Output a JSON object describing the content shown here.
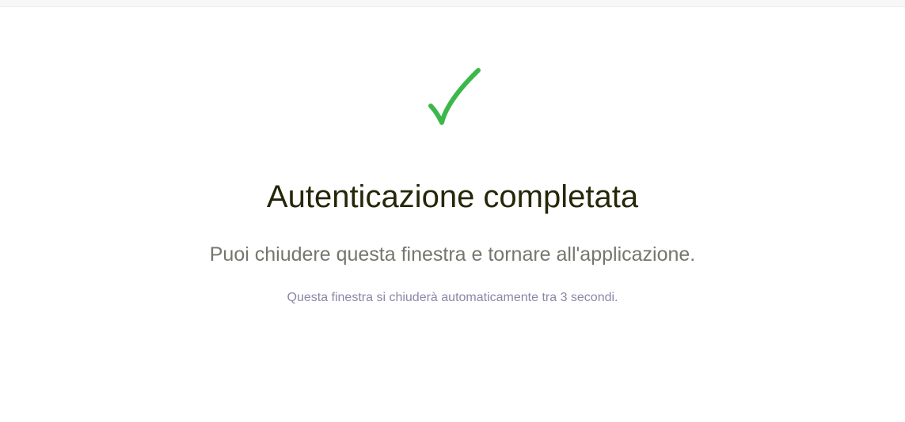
{
  "status": {
    "icon": "checkmark-icon",
    "icon_color": "#3cb84a",
    "title": "Autenticazione completata",
    "message": "Puoi chiudere questa finestra e tornare all'applicazione.",
    "countdown_text": "Questa finestra si chiuderà automaticamente tra 3 secondi."
  },
  "colors": {
    "title": "#262609",
    "message": "#76766e",
    "countdown": "#8a87a8",
    "background": "#ffffff"
  }
}
